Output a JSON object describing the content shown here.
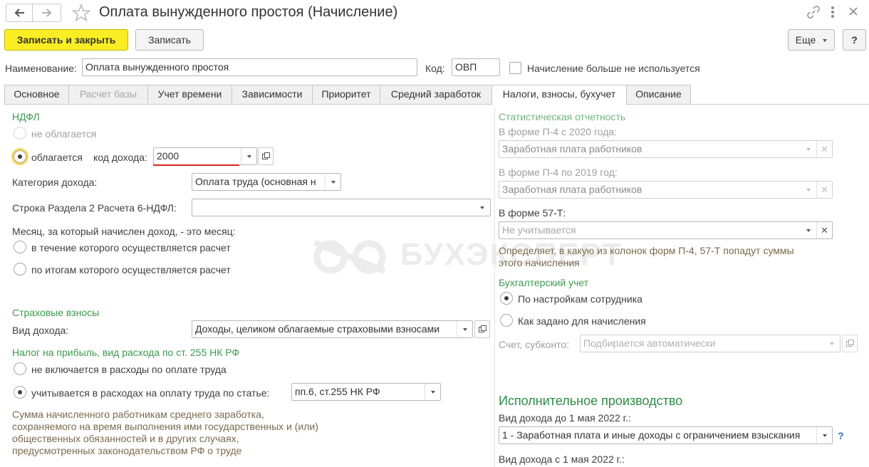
{
  "window": {
    "title": "Оплата вынужденного простоя (Начисление)"
  },
  "toolbar": {
    "save_close": "Записать и закрыть",
    "save": "Записать",
    "more": "Еще",
    "help": "?"
  },
  "header": {
    "name_label": "Наименование:",
    "name_value": "Оплата вынужденного простоя",
    "code_label": "Код:",
    "code_value": "ОВП",
    "not_used_label": "Начисление больше не используется"
  },
  "tabs": [
    {
      "label": "Основное"
    },
    {
      "label": "Расчет базы"
    },
    {
      "label": "Учет времени"
    },
    {
      "label": "Зависимости"
    },
    {
      "label": "Приоритет"
    },
    {
      "label": "Средний заработок"
    },
    {
      "label": "Налоги, взносы, бухучет"
    },
    {
      "label": "Описание"
    }
  ],
  "ndfl": {
    "title": "НДФЛ",
    "not_taxed": "не облагается",
    "taxed": "облагается",
    "income_code_label": "код дохода:",
    "income_code_value": "2000",
    "category_label": "Категория дохода:",
    "category_value": "Оплата труда (основная н",
    "line6_label": "Строка Раздела 2 Расчета 6-НДФЛ:",
    "line6_value": "",
    "month_label": "Месяц, за который начислен доход, - это месяц:",
    "month_opt1": "в течение которого осуществляется расчет",
    "month_opt2": "по итогам которого осуществляется расчет"
  },
  "insurance": {
    "title": "Страховые взносы",
    "income_type_label": "Вид дохода:",
    "income_type_value": "Доходы, целиком облагаемые страховыми взносами"
  },
  "profit_tax": {
    "title": "Налог на прибыль, вид расхода по ст. 255 НК РФ",
    "opt1": "не включается в расходы по оплате труда",
    "opt2": "учитывается в расходах на оплату труда по статье:",
    "article_value": "пп.6, ст.255 НК РФ",
    "note_line1": "Сумма начисленного работникам среднего заработка,",
    "note_line2": "сохраняемого на время выполнения ими государственных и (или)",
    "note_line3": "общественных обязанностей и в других случаях,",
    "note_line4": "предусмотренных законодательством РФ о труде"
  },
  "stats": {
    "title": "Статистическая отчетность",
    "p4_2020_label": "В форме П-4 с 2020 года:",
    "p4_2020_value": "Заработная плата работников",
    "p4_2019_label": "В форме П-4 по 2019 год:",
    "p4_2019_value": "Заработная плата работников",
    "f57_label": "В форме 57-Т:",
    "f57_placeholder": "Не учитывается",
    "note_line1": "Определяет, в какую из колонок форм П-4, 57-Т попадут суммы",
    "note_line2": "этого начисления"
  },
  "accounting": {
    "title": "Бухгалтерский учет",
    "opt1": "По настройкам сотрудника",
    "opt2": "Как задано для начисления",
    "account_label": "Счет, субконто:",
    "account_placeholder": "Подбирается автоматически"
  },
  "enforcement": {
    "title": "Исполнительное производство",
    "before_label": "Вид дохода до 1 мая 2022 г.:",
    "before_value": "1 - Заработная плата и иные доходы с ограничением взыскания",
    "help": "?",
    "after_label": "Вид дохода с 1 мая 2022 г.:"
  },
  "watermark": "БУХЭКСПЕРТ",
  "colors": {
    "primary_button": "#fbed24",
    "section_green": "#3c9a50",
    "red_underline": "#d9261c",
    "focus_ring": "#f5d85a"
  }
}
